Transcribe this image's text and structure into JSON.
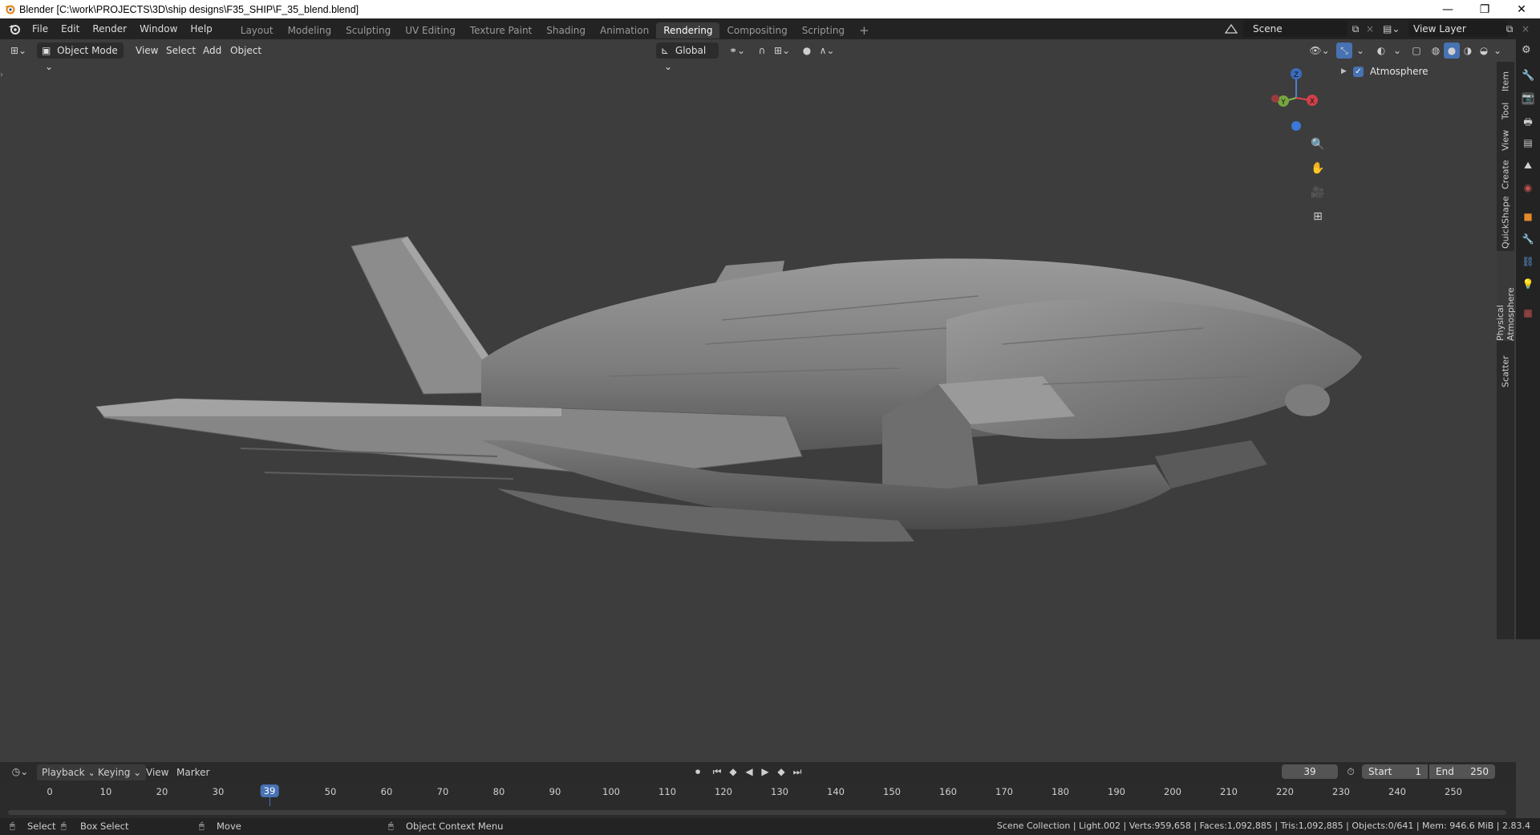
{
  "window": {
    "title": "Blender [C:\\work\\PROJECTS\\3D\\ship designs\\F35_SHIP\\F_35_blend.blend]",
    "minimize": "—",
    "maximize": "❐",
    "close": "✕"
  },
  "menus": [
    "File",
    "Edit",
    "Render",
    "Window",
    "Help"
  ],
  "workspaces": [
    "Layout",
    "Modeling",
    "Sculpting",
    "UV Editing",
    "Texture Paint",
    "Shading",
    "Animation",
    "Rendering",
    "Compositing",
    "Scripting"
  ],
  "active_workspace": "Rendering",
  "add_workspace": "+",
  "scene": {
    "label": "Scene"
  },
  "view_layer": {
    "label": "View Layer"
  },
  "viewport_header": {
    "mode": "Object Mode",
    "menus": [
      "View",
      "Select",
      "Add",
      "Object"
    ],
    "orientation": "Global"
  },
  "outliner": {
    "item": "Atmosphere"
  },
  "gizmo": {
    "z": "Z",
    "y": "Y",
    "x": "X"
  },
  "side_tabs": [
    "Item",
    "Tool",
    "View",
    "Create",
    "QuickShape",
    "Physical Atmosphere",
    "Scatter"
  ],
  "timeline": {
    "menus": [
      "Playback",
      "Keying",
      "View",
      "Marker"
    ],
    "current_frame": "39",
    "start_label": "Start",
    "start": "1",
    "end_label": "End",
    "end": "250",
    "ticks": [
      "0",
      "10",
      "20",
      "30",
      "39",
      "50",
      "60",
      "70",
      "80",
      "90",
      "100",
      "110",
      "120",
      "130",
      "140",
      "150",
      "160",
      "170",
      "180",
      "190",
      "200",
      "210",
      "220",
      "230",
      "240",
      "250"
    ]
  },
  "status": {
    "select": "Select",
    "box_select": "Box Select",
    "move": "Move",
    "context": "Object Context Menu",
    "info": "Scene Collection | Light.002 | Verts:959,658 | Faces:1,092,885 | Tris:1,092,885 | Objects:0/641 | Mem: 946.6 MiB | 2.83.4"
  },
  "colors": {
    "accent": "#4772b3",
    "viewport_bg": "#3d3d3d",
    "model": "#8a8a8a"
  }
}
